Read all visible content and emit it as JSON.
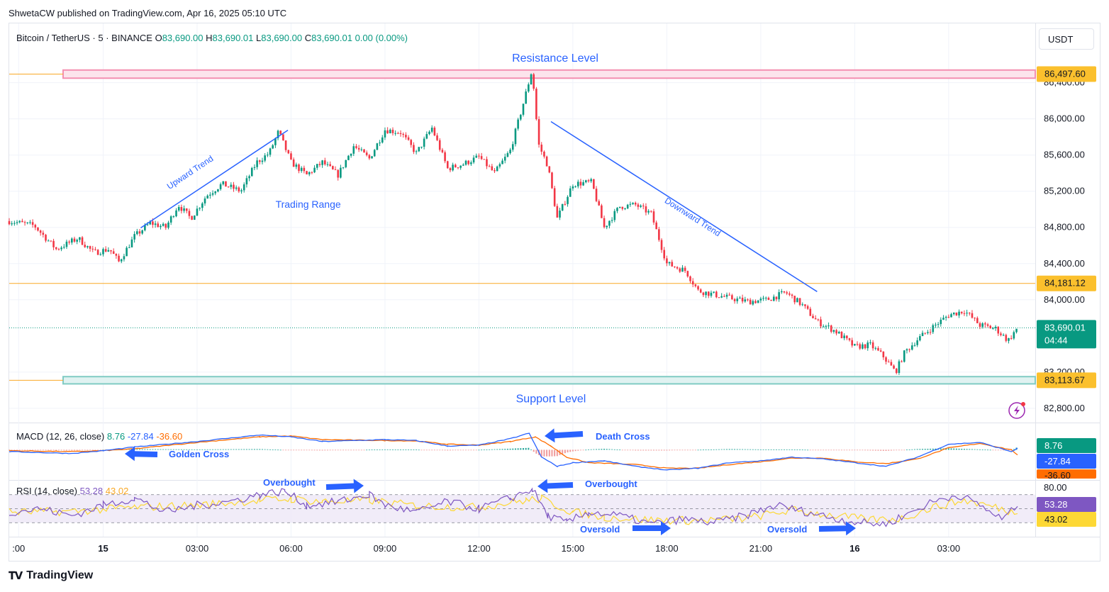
{
  "publisher_line": "ShwetaCW published on TradingView.com, Apr 16, 2025 05:10 UTC",
  "symbol": {
    "name": "Bitcoin / TetherUS · 5 · BINANCE",
    "o_label": "O",
    "o": "83,690.00",
    "h_label": "H",
    "h": "83,690.01",
    "l_label": "L",
    "l": "83,690.00",
    "c_label": "C",
    "c": "83,690.01",
    "change": "0.00 (0.00%)"
  },
  "currency_button": "USDT",
  "footer_logo": "TradingView",
  "colors": {
    "up": "#089981",
    "down": "#f23645",
    "annotation": "#2962ff",
    "resistance": "#f48fb1",
    "support": "#80cbc4",
    "hline": "#f9a825",
    "macd_line": "#2962ff",
    "signal_line": "#ff6d00",
    "rsi_line": "#7e57c2",
    "rsi_ma": "#fdd835",
    "rsi_band": "#ede7f6"
  },
  "chart_data": [
    {
      "type": "candlestick",
      "pane": "price",
      "ylim": [
        82650,
        86750
      ],
      "y_ticks": [
        "86,400.00",
        "86,000.00",
        "85,600.00",
        "85,200.00",
        "84,800.00",
        "84,400.00",
        "84,000.00",
        "83,200.00",
        "82,800.00"
      ],
      "y_tick_values": [
        86400,
        86000,
        85600,
        85200,
        84800,
        84400,
        84000,
        83200,
        82800
      ],
      "x_ticks": [
        ":00",
        "15",
        "03:00",
        "06:00",
        "09:00",
        "12:00",
        "15:00",
        "18:00",
        "21:00",
        "16",
        "03:00"
      ],
      "x_tick_hours": [
        -2.7,
        0,
        3,
        6,
        9,
        12,
        15,
        18,
        21,
        24,
        27
      ],
      "bold_x_ticks": [
        "15",
        "16"
      ],
      "x_range_hours": [
        -3.0,
        29.2
      ],
      "close_path": [
        [
          -3.0,
          84870
        ],
        [
          -2.2,
          84820
        ],
        [
          -1.5,
          84560
        ],
        [
          -0.8,
          84680
        ],
        [
          -0.3,
          84520
        ],
        [
          0.2,
          84560
        ],
        [
          0.5,
          84420
        ],
        [
          1.0,
          84700
        ],
        [
          1.5,
          84850
        ],
        [
          2.0,
          84800
        ],
        [
          2.4,
          85050
        ],
        [
          2.8,
          84900
        ],
        [
          3.3,
          85150
        ],
        [
          3.8,
          85280
        ],
        [
          4.4,
          85200
        ],
        [
          4.9,
          85520
        ],
        [
          5.3,
          85620
        ],
        [
          5.6,
          85860
        ],
        [
          6.0,
          85520
        ],
        [
          6.5,
          85380
        ],
        [
          7.0,
          85520
        ],
        [
          7.5,
          85380
        ],
        [
          8.0,
          85700
        ],
        [
          8.5,
          85560
        ],
        [
          9.0,
          85880
        ],
        [
          9.5,
          85850
        ],
        [
          10.0,
          85620
        ],
        [
          10.5,
          85900
        ],
        [
          11.0,
          85450
        ],
        [
          11.5,
          85500
        ],
        [
          12.0,
          85580
        ],
        [
          12.5,
          85400
        ],
        [
          13.0,
          85650
        ],
        [
          13.4,
          86150
        ],
        [
          13.7,
          86550
        ],
        [
          13.9,
          85720
        ],
        [
          14.2,
          85480
        ],
        [
          14.5,
          84900
        ],
        [
          15.0,
          85280
        ],
        [
          15.6,
          85300
        ],
        [
          16.0,
          84800
        ],
        [
          16.5,
          85030
        ],
        [
          17.0,
          85050
        ],
        [
          17.5,
          84950
        ],
        [
          18.0,
          84400
        ],
        [
          18.6,
          84320
        ],
        [
          19.0,
          84100
        ],
        [
          19.6,
          84050
        ],
        [
          20.0,
          84020
        ],
        [
          20.6,
          83980
        ],
        [
          21.2,
          84000
        ],
        [
          21.8,
          84080
        ],
        [
          22.3,
          83950
        ],
        [
          22.8,
          83760
        ],
        [
          23.4,
          83650
        ],
        [
          24.0,
          83480
        ],
        [
          24.5,
          83500
        ],
        [
          24.9,
          83380
        ],
        [
          25.3,
          83200
        ],
        [
          25.6,
          83420
        ],
        [
          26.0,
          83560
        ],
        [
          26.5,
          83700
        ],
        [
          27.0,
          83830
        ],
        [
          27.5,
          83880
        ],
        [
          28.0,
          83720
        ],
        [
          28.5,
          83680
        ],
        [
          28.9,
          83550
        ],
        [
          29.2,
          83690
        ]
      ],
      "last_price": "83,690.01",
      "countdown": "04:44",
      "resistance": {
        "label": "Resistance Level",
        "price_label": "86,497.60",
        "low": 86450,
        "high": 86540
      },
      "support": {
        "label": "Support Level",
        "price_label": "83,113.67",
        "low": 83070,
        "high": 83150
      },
      "horizontal_line": {
        "price": 84181.12,
        "price_label": "84,181.12"
      },
      "trendlines": [
        {
          "label": "Upward Trend",
          "from": [
            1.2,
            84795
          ],
          "to": [
            5.9,
            85875
          ]
        },
        {
          "label": "Downward Trend",
          "from": [
            14.3,
            85970
          ],
          "to": [
            22.8,
            84090
          ]
        }
      ],
      "annotations": [
        {
          "text": "Trading Range",
          "x": 7.0,
          "y": 85050
        }
      ]
    },
    {
      "type": "line",
      "pane": "macd",
      "title": "MACD (12, 26, close)",
      "values": {
        "macd": "8.76",
        "signal": "-27.84",
        "hist": "-36.60"
      },
      "series": [
        {
          "name": "MACD",
          "values": [
            [
              -3,
              -10
            ],
            [
              -1,
              -20
            ],
            [
              0,
              -5
            ],
            [
              1,
              15
            ],
            [
              3,
              45
            ],
            [
              5,
              80
            ],
            [
              6,
              70
            ],
            [
              7,
              45
            ],
            [
              9,
              55
            ],
            [
              10,
              50
            ],
            [
              11,
              20
            ],
            [
              12,
              25
            ],
            [
              13,
              60
            ],
            [
              13.6,
              90
            ],
            [
              14,
              -40
            ],
            [
              14.5,
              -90
            ],
            [
              15,
              -70
            ],
            [
              16,
              -60
            ],
            [
              17,
              -90
            ],
            [
              18,
              -110
            ],
            [
              19,
              -100
            ],
            [
              20,
              -70
            ],
            [
              21,
              -60
            ],
            [
              22,
              -40
            ],
            [
              23,
              -50
            ],
            [
              24,
              -70
            ],
            [
              25,
              -90
            ],
            [
              26,
              -40
            ],
            [
              27,
              30
            ],
            [
              28,
              40
            ],
            [
              29,
              -10
            ],
            [
              29.2,
              8.76
            ]
          ]
        },
        {
          "name": "Signal",
          "values": [
            [
              -3,
              -5
            ],
            [
              -1,
              -10
            ],
            [
              0,
              -5
            ],
            [
              1,
              5
            ],
            [
              3,
              40
            ],
            [
              5,
              70
            ],
            [
              6,
              75
            ],
            [
              7,
              55
            ],
            [
              9,
              50
            ],
            [
              10,
              48
            ],
            [
              11,
              30
            ],
            [
              12,
              25
            ],
            [
              13,
              45
            ],
            [
              13.8,
              70
            ],
            [
              14.3,
              20
            ],
            [
              14.8,
              -40
            ],
            [
              15.5,
              -70
            ],
            [
              17,
              -80
            ],
            [
              18,
              -100
            ],
            [
              19,
              -100
            ],
            [
              20,
              -80
            ],
            [
              21,
              -65
            ],
            [
              22,
              -45
            ],
            [
              23,
              -45
            ],
            [
              24,
              -65
            ],
            [
              25,
              -75
            ],
            [
              26,
              -50
            ],
            [
              27,
              10
            ],
            [
              28,
              35
            ],
            [
              29,
              0
            ],
            [
              29.2,
              -27.84
            ]
          ]
        }
      ],
      "annotations": [
        "Golden Cross",
        "Death Cross"
      ]
    },
    {
      "type": "line",
      "pane": "rsi",
      "title": "RSI (14, close)",
      "values": {
        "rsi": "53.28",
        "ma": "43.02"
      },
      "levels": [
        "80.00"
      ],
      "band": [
        30,
        70
      ],
      "series": [
        {
          "name": "RSI",
          "values": [
            [
              -3,
              45
            ],
            [
              -2,
              50
            ],
            [
              -1,
              40
            ],
            [
              0,
              55
            ],
            [
              1,
              65
            ],
            [
              2,
              45
            ],
            [
              3,
              55
            ],
            [
              4,
              60
            ],
            [
              5,
              70
            ],
            [
              5.8,
              75
            ],
            [
              6.5,
              55
            ],
            [
              7.5,
              60
            ],
            [
              8.5,
              70
            ],
            [
              9,
              55
            ],
            [
              10,
              45
            ],
            [
              11,
              60
            ],
            [
              12,
              50
            ],
            [
              13,
              65
            ],
            [
              13.7,
              78
            ],
            [
              14.2,
              40
            ],
            [
              14.8,
              30
            ],
            [
              15.5,
              45
            ],
            [
              16.5,
              40
            ],
            [
              17.5,
              28
            ],
            [
              18.5,
              35
            ],
            [
              19.5,
              30
            ],
            [
              20.5,
              40
            ],
            [
              21.5,
              55
            ],
            [
              22.5,
              45
            ],
            [
              23.5,
              35
            ],
            [
              24.2,
              30
            ],
            [
              25,
              28
            ],
            [
              25.8,
              45
            ],
            [
              26.5,
              60
            ],
            [
              27.3,
              70
            ],
            [
              28,
              55
            ],
            [
              28.7,
              35
            ],
            [
              29.2,
              53.28
            ]
          ]
        },
        {
          "name": "RSI MA",
          "values": [
            [
              -3,
              45
            ],
            [
              -1,
              46
            ],
            [
              1,
              52
            ],
            [
              3,
              55
            ],
            [
              5,
              62
            ],
            [
              6,
              64
            ],
            [
              7,
              60
            ],
            [
              8.5,
              62
            ],
            [
              10,
              54
            ],
            [
              12,
              52
            ],
            [
              13.5,
              62
            ],
            [
              14,
              64
            ],
            [
              15,
              45
            ],
            [
              16,
              38
            ],
            [
              17.5,
              34
            ],
            [
              19,
              33
            ],
            [
              20.5,
              36
            ],
            [
              22,
              48
            ],
            [
              23,
              42
            ],
            [
              24.5,
              34
            ],
            [
              25.5,
              36
            ],
            [
              26.5,
              52
            ],
            [
              27.5,
              62
            ],
            [
              28.5,
              52
            ],
            [
              29.2,
              43.02
            ]
          ]
        }
      ],
      "annotations": [
        "Overbought",
        "Overbought",
        "Oversold",
        "Oversold"
      ]
    }
  ]
}
